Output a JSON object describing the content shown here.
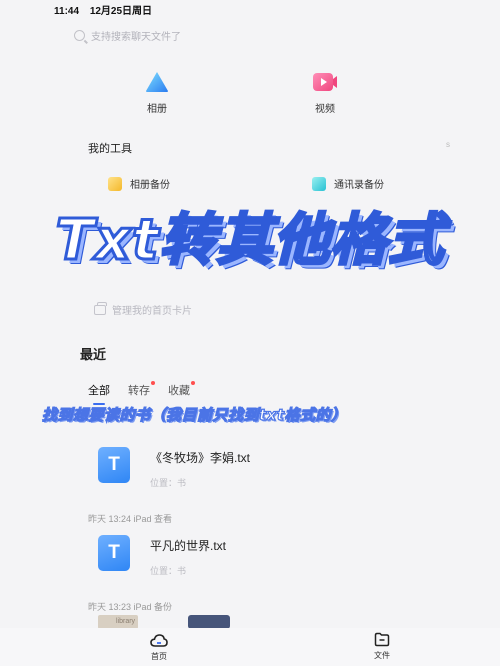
{
  "status_bar": {
    "time": "11:44",
    "date": "12月25日周日"
  },
  "search": {
    "placeholder": "支持搜索聊天文件了"
  },
  "quick_access": [
    {
      "label": "相册",
      "icon": "album-triangle-icon"
    },
    {
      "label": "视频",
      "icon": "video-icon"
    }
  ],
  "tools": {
    "title": "我的工具",
    "more": "s",
    "items": [
      {
        "label": "相册备份",
        "icon": "album-backup-icon",
        "color": "#f4b82a"
      },
      {
        "label": "通讯录备份",
        "icon": "contacts-backup-icon",
        "color": "#27c1d3"
      }
    ]
  },
  "overlay": {
    "title": "Txt转其他格式",
    "note": "找到想要读的书（我目前只找到txt格式的）"
  },
  "manage_cards": "管理我的首页卡片",
  "recent": {
    "title": "最近",
    "tabs": [
      "全部",
      "转存",
      "收藏"
    ],
    "files": [
      {
        "name": "《冬牧场》李娟.txt",
        "location": "位置：书"
      },
      {
        "name": "平凡的世界.txt",
        "location": "位置：书"
      }
    ],
    "meta": [
      "昨天 13:24 iPad 查看",
      "昨天 13:23 iPad 备份"
    ],
    "thumb_text": "library"
  },
  "bottom_nav": {
    "home": "首页",
    "files": "文件"
  },
  "colors": {
    "accent": "#3a6df0",
    "banner_stroke": "#2f5bd8",
    "file_icon": "#2f86f5",
    "badge": "#ff4e4e"
  }
}
